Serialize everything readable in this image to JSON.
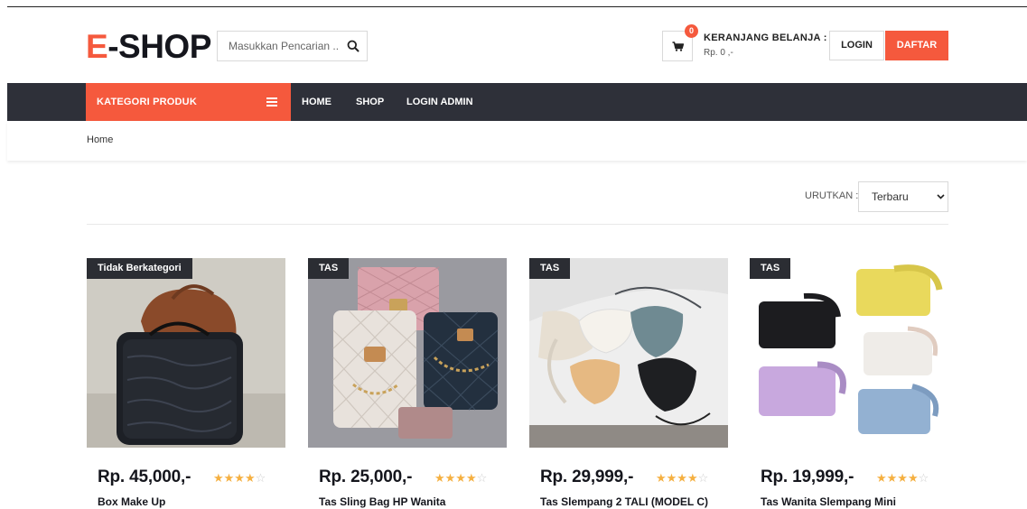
{
  "brand": {
    "logo_first": "E",
    "logo_rest": "-SHOP",
    "accent_color": "#f5593d",
    "dark_color": "#2e3039"
  },
  "search": {
    "placeholder": "Masukkan Pencarian ..",
    "icon": "search-icon"
  },
  "cart": {
    "count": "0",
    "title": "KERANJANG BELANJA :",
    "total": "Rp. 0 ,-",
    "icon": "cart-icon"
  },
  "auth": {
    "login": "LOGIN",
    "register": "DAFTAR"
  },
  "nav": {
    "category_label": "KATEGORI PRODUK",
    "category_icon": "menu-icon",
    "items": [
      "HOME",
      "SHOP",
      "LOGIN ADMIN"
    ]
  },
  "breadcrumb": {
    "current": "Home"
  },
  "sort": {
    "label": "URUTKAN :",
    "selected": "Terbaru"
  },
  "products": [
    {
      "tag": "Tidak Berkategori",
      "price": "Rp. 45,000,-",
      "name": "Box Make Up",
      "rating": 4,
      "rating_max": 5
    },
    {
      "tag": "TAS",
      "price": "Rp. 25,000,-",
      "name": "Tas Sling Bag HP Wanita",
      "rating": 4,
      "rating_max": 5
    },
    {
      "tag": "TAS",
      "price": "Rp. 29,999,-",
      "name": "Tas Slempang 2 TALI (MODEL C)",
      "rating": 4,
      "rating_max": 5
    },
    {
      "tag": "TAS",
      "price": "Rp. 19,999,-",
      "name": "Tas Wanita Slempang Mini",
      "rating": 4,
      "rating_max": 5
    }
  ]
}
